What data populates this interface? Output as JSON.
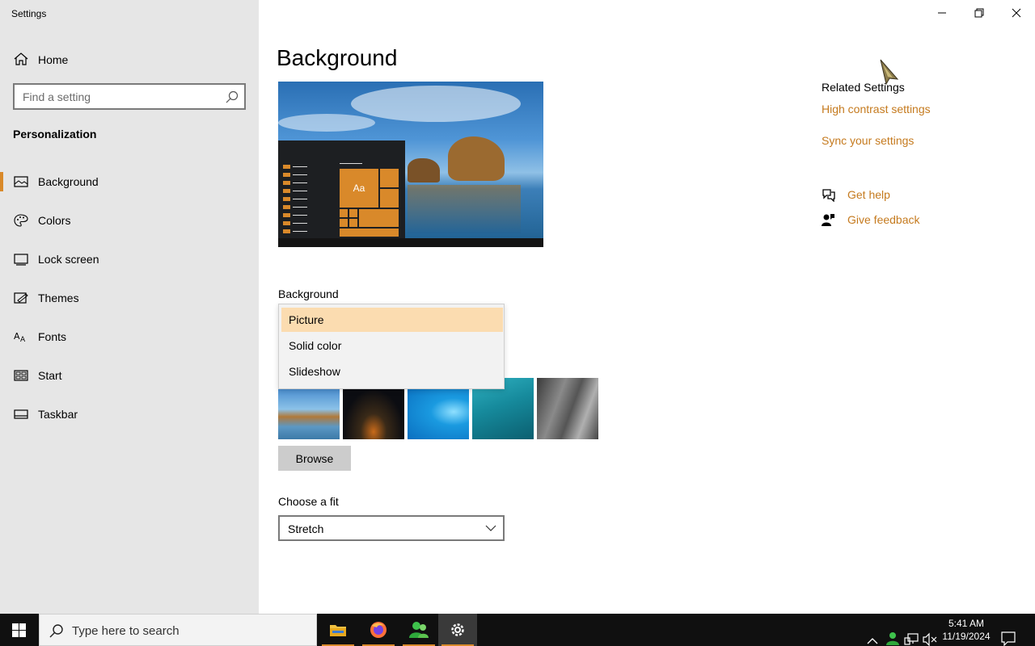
{
  "window": {
    "title": "Settings",
    "controls": [
      "minimize-button",
      "restore-button",
      "close-button"
    ]
  },
  "sidebar": {
    "home_label": "Home",
    "search_placeholder": "Find a setting",
    "section_heading": "Personalization",
    "items": [
      {
        "label": "Background",
        "icon": "picture-icon",
        "active": true
      },
      {
        "label": "Colors",
        "icon": "palette-icon"
      },
      {
        "label": "Lock screen",
        "icon": "lock-screen-icon"
      },
      {
        "label": "Themes",
        "icon": "themes-icon"
      },
      {
        "label": "Fonts",
        "icon": "fonts-icon"
      },
      {
        "label": "Start",
        "icon": "start-icon"
      },
      {
        "label": "Taskbar",
        "icon": "taskbar-icon"
      }
    ]
  },
  "main": {
    "title": "Background",
    "preview_tile_text": "Aa",
    "background_label": "Background",
    "dropdown_options": [
      {
        "label": "Picture",
        "selected": true
      },
      {
        "label": "Solid color"
      },
      {
        "label": "Slideshow"
      }
    ],
    "browse_label": "Browse",
    "fit_label": "Choose a fit",
    "fit_value": "Stretch"
  },
  "related": {
    "heading": "Related Settings",
    "high_contrast": "High contrast settings",
    "sync": "Sync your settings",
    "get_help": "Get help",
    "give_feedback": "Give feedback"
  },
  "taskbar": {
    "search_placeholder": "Type here to search",
    "time": "5:41 AM",
    "date": "11/19/2024"
  },
  "colors": {
    "accent": "#d9892a",
    "link": "#c57a1e",
    "selected_option": "#fbdcb0"
  }
}
